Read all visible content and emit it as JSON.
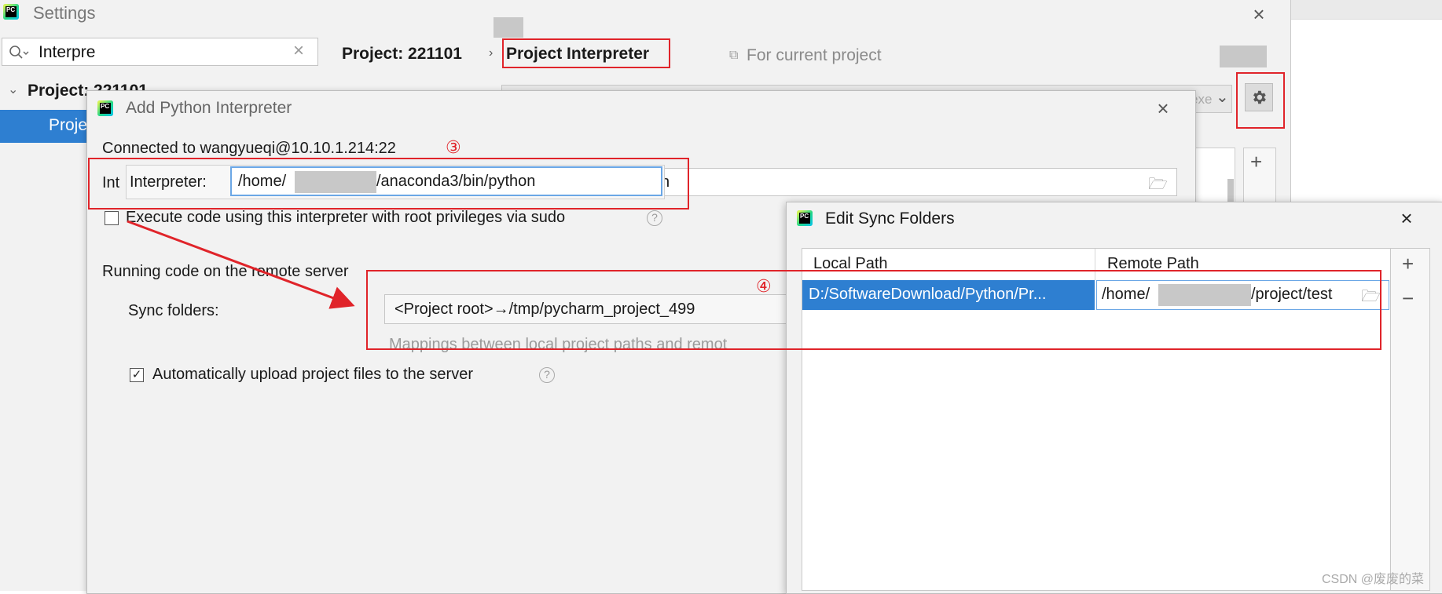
{
  "settings": {
    "title": "Settings",
    "search_value": "Interpre",
    "tree_project": "Project: 221101",
    "tree_child": "Proje",
    "breadcrumb_project": "Project: 221101",
    "breadcrumb_current": "Project Interpreter",
    "for_current_project": "For current project",
    "combo_fragment": "exe"
  },
  "add_interpreter": {
    "title": "Add Python Interpreter",
    "connected": "Connected to wangyueqi@10.10.1.214:22",
    "step3": "③",
    "interpreter_label_bg": "Int",
    "interpreter_label": "Interpreter:",
    "interpreter_path_prefix": "/home/",
    "interpreter_path_suffix": "/anaconda3/bin/python",
    "interpreter_bg_fragment": "n",
    "sudo_label": "Execute code using this interpreter with root privileges via sudo",
    "running_code": "Running code on the remote server",
    "sync_label": "Sync folders:",
    "sync_value": "<Project root>→/tmp/pycharm_project_499",
    "mappings_hint": "Mappings between local project paths and remot",
    "auto_upload": "Automatically upload project files to the server",
    "step4": "④"
  },
  "sync_dialog": {
    "title": "Edit Sync Folders",
    "columns": [
      "Local Path",
      "Remote Path"
    ],
    "row_local": "D:/SoftwareDownload/Python/Pr...",
    "row_remote_prefix": "/home/",
    "row_remote_suffix": "/project/test",
    "add": "+",
    "remove": "−"
  },
  "watermark": "CSDN @废废的菜",
  "colors": {
    "accent": "#2675bf",
    "annotation": "#e0242a",
    "selection": "#2e7fd1"
  }
}
